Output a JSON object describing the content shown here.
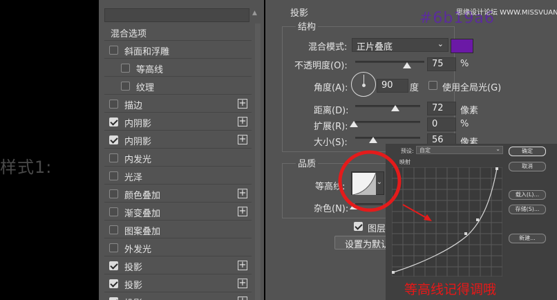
{
  "left_label": "样式1:",
  "annotation_hex": "#6b19a6",
  "watermark": "思缘设计论坛 WWW.MISSVUAN.COM",
  "note": "等高线记得调哦",
  "style_list": {
    "items": [
      {
        "label": "混合选项",
        "checkbox": null,
        "plus": false,
        "indent": false
      },
      {
        "label": "斜面和浮雕",
        "checkbox": false,
        "plus": false,
        "indent": false
      },
      {
        "label": "等高线",
        "checkbox": false,
        "plus": false,
        "indent": true
      },
      {
        "label": "纹理",
        "checkbox": false,
        "plus": false,
        "indent": true
      },
      {
        "label": "描边",
        "checkbox": false,
        "plus": true,
        "indent": false
      },
      {
        "label": "内阴影",
        "checkbox": true,
        "plus": true,
        "indent": false
      },
      {
        "label": "内阴影",
        "checkbox": true,
        "plus": true,
        "indent": false
      },
      {
        "label": "内发光",
        "checkbox": false,
        "plus": false,
        "indent": false
      },
      {
        "label": "光泽",
        "checkbox": false,
        "plus": false,
        "indent": false
      },
      {
        "label": "颜色叠加",
        "checkbox": false,
        "plus": true,
        "indent": false
      },
      {
        "label": "渐变叠加",
        "checkbox": false,
        "plus": true,
        "indent": false
      },
      {
        "label": "图案叠加",
        "checkbox": false,
        "plus": false,
        "indent": false
      },
      {
        "label": "外发光",
        "checkbox": false,
        "plus": false,
        "indent": false
      },
      {
        "label": "投影",
        "checkbox": true,
        "plus": true,
        "indent": false
      },
      {
        "label": "投影",
        "checkbox": true,
        "plus": true,
        "indent": false
      },
      {
        "label": "投影",
        "checkbox": true,
        "plus": true,
        "indent": false
      }
    ]
  },
  "settings": {
    "section_title": "投影",
    "structure_title": "结构",
    "blend_mode_label": "混合模式:",
    "blend_mode_value": "正片叠底",
    "shadow_color": "#6b19a6",
    "opacity_label": "不透明度(O):",
    "opacity_value": "75",
    "opacity_unit": "%",
    "opacity_level": 0.75,
    "angle_label": "角度(A):",
    "angle_value": "90",
    "angle_unit": "度",
    "global_light_label": "使用全局光(G)",
    "global_light_checked": false,
    "distance_label": "距离(D):",
    "distance_value": "72",
    "distance_unit": "像素",
    "spread_label": "扩展(R):",
    "spread_value": "0",
    "spread_unit": "%",
    "size_label": "大小(S):",
    "size_value": "56",
    "size_unit": "像素",
    "quality_title": "品质",
    "contour_label": "等高线:",
    "noise_label": "杂色(N):",
    "layer_knockout_label": "图层",
    "layer_knockout_checked": true,
    "set_default_label": "设置为默认"
  },
  "curve_editor": {
    "preset_label": "预设:",
    "preset_value": "自定",
    "mapping_label": "映射",
    "ok_label": "确定",
    "cancel_label": "取消",
    "load_label": "载入(L)...",
    "save_label": "存储(S)...",
    "new_label": "新建..."
  }
}
